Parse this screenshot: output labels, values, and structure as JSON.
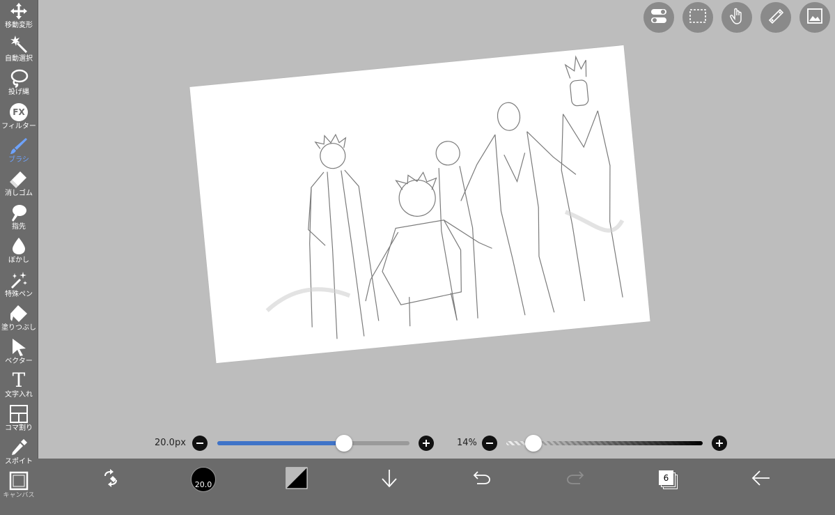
{
  "tools": [
    {
      "label": "移動変形",
      "icon": "move-transform-icon",
      "active": false
    },
    {
      "label": "自動選択",
      "icon": "magic-wand-icon",
      "active": false
    },
    {
      "label": "投げ縄",
      "icon": "lasso-icon",
      "active": false
    },
    {
      "label": "フィルター",
      "icon": "fx-filter-icon",
      "active": false
    },
    {
      "label": "ブラシ",
      "icon": "brush-icon",
      "active": true
    },
    {
      "label": "消しゴム",
      "icon": "eraser-icon",
      "active": false
    },
    {
      "label": "指先",
      "icon": "finger-smudge-icon",
      "active": false
    },
    {
      "label": "ぼかし",
      "icon": "blur-drop-icon",
      "active": false
    },
    {
      "label": "特殊ペン",
      "icon": "special-pen-icon",
      "active": false
    },
    {
      "label": "塗りつぶし",
      "icon": "fill-bucket-icon",
      "active": false
    },
    {
      "label": "ベクター",
      "icon": "vector-cursor-icon",
      "active": false
    },
    {
      "label": "文字入れ",
      "icon": "text-tool-icon",
      "active": false
    },
    {
      "label": "コマ割り",
      "icon": "panel-divide-icon",
      "active": false
    },
    {
      "label": "スポイト",
      "icon": "eyedropper-icon",
      "active": false
    },
    {
      "label": "キャンバス",
      "icon": "canvas-icon",
      "active": false
    }
  ],
  "fx_text": "FX",
  "text_tool_glyph": "T",
  "brush": {
    "size_label": "20.0px",
    "size_fraction": 0.66,
    "cursor_value": "20.0"
  },
  "opacity": {
    "label": "14%",
    "fraction": 0.14
  },
  "layers": {
    "count": "6"
  },
  "colors": {
    "toolbar_bg": "#6b6b6b",
    "workspace_bg": "#bdbdbd",
    "accent": "#3f73c8",
    "active_tool": "#6ea3ff"
  },
  "top_buttons": [
    "toggle-panel-icon",
    "selection-icon",
    "touch-gesture-icon",
    "ruler-icon",
    "material-image-icon"
  ],
  "bottom_buttons": [
    "swap-colors-icon",
    "brush-size-icon",
    "color-swatch-icon",
    "download-icon",
    "undo-icon",
    "redo-icon",
    "layers-icon",
    "back-arrow-icon"
  ]
}
